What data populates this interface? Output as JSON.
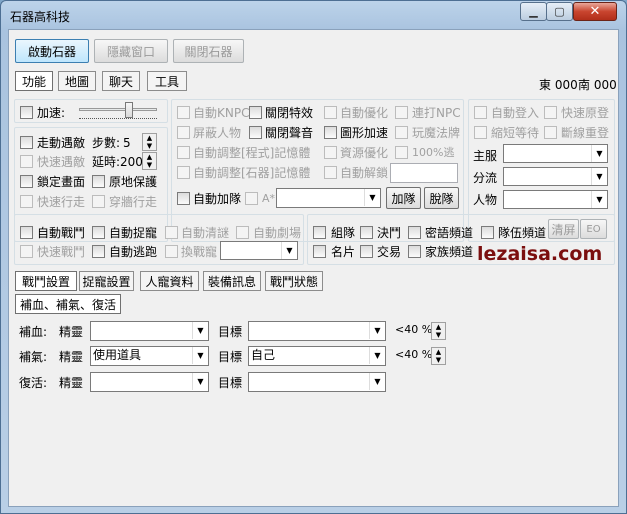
{
  "window": {
    "title": "石器高科技",
    "min_icon": "minimize-icon",
    "max_icon": "maximize-icon",
    "close_icon": "close-icon",
    "min_glyph": "▁",
    "max_glyph": "▢",
    "close_glyph": "✕"
  },
  "top_buttons": {
    "start": "啟動石器",
    "hide": "隱藏窗口",
    "close": "關閉石器"
  },
  "main_tabs": [
    "功能",
    "地圖",
    "聊天",
    "工具"
  ],
  "coords": {
    "east": "東 000",
    "south": "南 000"
  },
  "speed": {
    "label": "加速:"
  },
  "walk": {
    "walk_enc": "走動遇敵",
    "steps_label": "步數:",
    "steps_value": "5",
    "fast_enc": "快速遇敵",
    "delay_label": "延時:",
    "delay_value": "200",
    "lock_screen": "鎖定畫面",
    "stay_put": "原地保護",
    "fast_walk": "快速行走",
    "wall_walk": "穿牆行走"
  },
  "mid": {
    "auto_knpc": "自動KNPC",
    "close_fx": "關閉特效",
    "auto_opt": "自動優化",
    "hit_npc": "連打NPC",
    "block_people": "屏蔽人物",
    "close_sound": "關閉聲音",
    "shape_accel": "圖形加速",
    "play_magic": "玩魔法牌",
    "auto_adj_prog": "自動調整[程式]記憶體",
    "res_opt": "資源優化",
    "pct_escape": "100%逃",
    "auto_adj_sa": "自動調整[石器]記憶體",
    "auto_unlock": "自動解鎖",
    "auto_join": "自動加隊",
    "a_star": "A*",
    "join_btn": "加隊",
    "leave_btn": "脫隊"
  },
  "right": {
    "auto_login": "自動登入",
    "fast_return": "快速原登",
    "shorten_wait": "縮短等待",
    "reconnect": "斷線重登",
    "server": "主服",
    "branch": "分流",
    "character": "人物"
  },
  "battle": {
    "auto_battle": "自動戰鬥",
    "auto_catch": "自動捉寵",
    "auto_quest": "自動清謎",
    "auto_drama": "自動劇場",
    "fast_battle": "快速戰鬥",
    "auto_escape": "自動逃跑",
    "swap_pet": "換戰寵"
  },
  "channels": {
    "team": "組隊",
    "duel": "決鬥",
    "secret": "密語頻道",
    "team_ch": "隊伍頻道",
    "card": "名片",
    "trade": "交易",
    "family": "家族頻道",
    "clear_btn": "清屏",
    "eo_btn": "EO"
  },
  "watermark": "lezaisa.com",
  "sub_tabs": [
    "戰鬥設置",
    "捉寵設置",
    "人寵資料",
    "裝備訊息",
    "戰鬥狀態"
  ],
  "section_tab": "補血、補氣、復活",
  "rows": [
    {
      "label": "補血:",
      "who": "精靈",
      "value": "",
      "target_label": "目標",
      "target": "",
      "pct": "<40 %"
    },
    {
      "label": "補氣:",
      "who": "精靈",
      "value": "使用道具",
      "target_label": "目標",
      "target": "自己",
      "pct": "<40 %"
    },
    {
      "label": "復活:",
      "who": "精靈",
      "value": "",
      "target_label": "目標",
      "target": "",
      "pct": ""
    }
  ],
  "spin_up": "▲",
  "spin_down": "▼",
  "arrow_glyph": "▼",
  "colors": {
    "title_bar": "#bcd3ea",
    "close_red": "#c9452f",
    "watermark": "#7b0f0f",
    "client_bg": "#f0f0f0"
  }
}
